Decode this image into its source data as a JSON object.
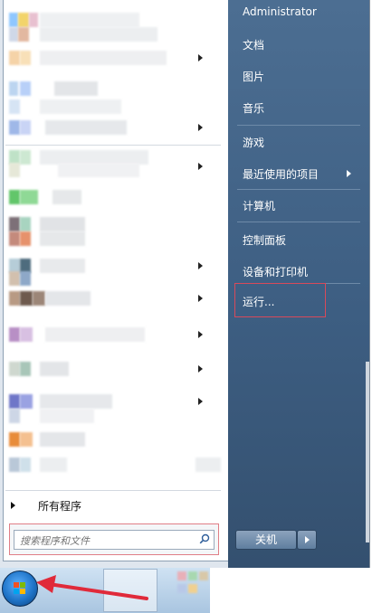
{
  "start_menu": {
    "all_programs_label": "所有程序",
    "search": {
      "placeholder": "搜索程序和文件"
    },
    "right_pane": {
      "user": "Administrator",
      "documents": "文档",
      "pictures": "图片",
      "music": "音乐",
      "games": "游戏",
      "recent_items": "最近使用的项目",
      "computer": "计算机",
      "control_panel": "控制面板",
      "devices_printers": "设备和打印机",
      "run": "运行..."
    },
    "shutdown_label": "关机"
  },
  "colors": {
    "right_pane": "#3d5e82",
    "highlight_box": "#d84a5a",
    "arrow": "#e02a3a"
  },
  "icons": [
    "search-icon",
    "windows-logo-icon",
    "chevron-right-icon"
  ]
}
